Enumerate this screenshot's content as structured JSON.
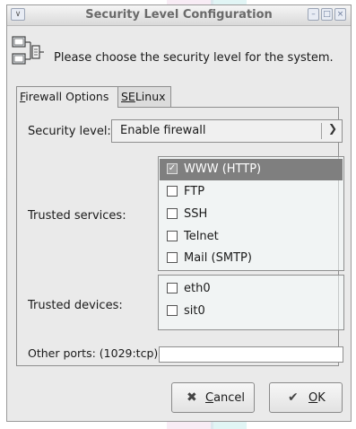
{
  "window": {
    "title": "Security Level Configuration"
  },
  "header": {
    "prompt": "Please choose the security level for the system."
  },
  "tabs": [
    {
      "mnemonic": "F",
      "rest": "irewall Options"
    },
    {
      "mnemonic": "SE",
      "rest": "Linux"
    }
  ],
  "security_level": {
    "label": "Security level:",
    "value": "Enable firewall"
  },
  "trusted_services": {
    "label": "Trusted services:",
    "items": [
      {
        "label": "WWW (HTTP)",
        "checked": true,
        "selected": true
      },
      {
        "label": "FTP",
        "checked": false
      },
      {
        "label": "SSH",
        "checked": false
      },
      {
        "label": "Telnet",
        "checked": false
      },
      {
        "label": "Mail (SMTP)",
        "checked": false
      }
    ]
  },
  "trusted_devices": {
    "label": "Trusted devices:",
    "items": [
      {
        "label": "eth0",
        "checked": false
      },
      {
        "label": "sit0",
        "checked": false
      }
    ]
  },
  "other_ports": {
    "label": "Other ports: (1029:tcp)",
    "value": ""
  },
  "buttons": {
    "cancel": {
      "mnemonic": "C",
      "rest": "ancel"
    },
    "ok": {
      "mnemonic": "O",
      "rest": "K"
    }
  },
  "colors": {
    "selection": "#7f7f7f",
    "window_bg": "#eaeaea",
    "border": "#8f8f8f"
  }
}
